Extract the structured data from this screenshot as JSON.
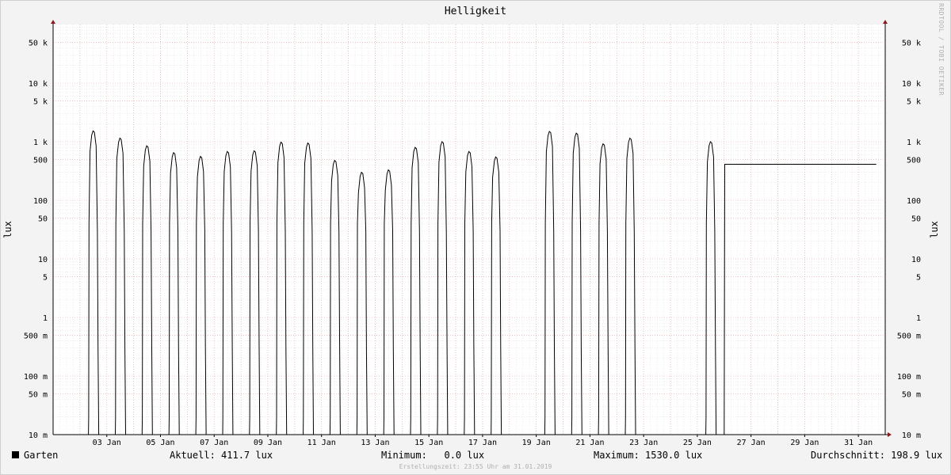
{
  "chart_data": {
    "type": "line",
    "title": "Helligkeit",
    "ylabel": "lux",
    "y_scale": "log",
    "ylim": [
      0.01,
      100000
    ],
    "xlim": [
      "2019-01-01T00:00",
      "2019-02-01T00:00"
    ],
    "y_ticks": [
      {
        "value": 0.01,
        "label": "10 m"
      },
      {
        "value": 0.05,
        "label": "50 m"
      },
      {
        "value": 0.1,
        "label": "100 m"
      },
      {
        "value": 0.5,
        "label": "500 m"
      },
      {
        "value": 1,
        "label": "1"
      },
      {
        "value": 5,
        "label": "5"
      },
      {
        "value": 10,
        "label": "10"
      },
      {
        "value": 50,
        "label": "50"
      },
      {
        "value": 100,
        "label": "100"
      },
      {
        "value": 500,
        "label": "500"
      },
      {
        "value": 1000,
        "label": "1 k"
      },
      {
        "value": 5000,
        "label": "5 k"
      },
      {
        "value": 10000,
        "label": "10 k"
      },
      {
        "value": 50000,
        "label": "50 k"
      }
    ],
    "x_ticks": [
      {
        "value": "2019-01-03",
        "label": "03 Jan"
      },
      {
        "value": "2019-01-05",
        "label": "05 Jan"
      },
      {
        "value": "2019-01-07",
        "label": "07 Jan"
      },
      {
        "value": "2019-01-09",
        "label": "09 Jan"
      },
      {
        "value": "2019-01-11",
        "label": "11 Jan"
      },
      {
        "value": "2019-01-13",
        "label": "13 Jan"
      },
      {
        "value": "2019-01-15",
        "label": "15 Jan"
      },
      {
        "value": "2019-01-17",
        "label": "17 Jan"
      },
      {
        "value": "2019-01-19",
        "label": "19 Jan"
      },
      {
        "value": "2019-01-21",
        "label": "21 Jan"
      },
      {
        "value": "2019-01-23",
        "label": "23 Jan"
      },
      {
        "value": "2019-01-25",
        "label": "25 Jan"
      },
      {
        "value": "2019-01-27",
        "label": "27 Jan"
      },
      {
        "value": "2019-01-29",
        "label": "29 Jan"
      },
      {
        "value": "2019-01-31",
        "label": "31 Jan"
      }
    ],
    "grid": true,
    "series": [
      {
        "name": "Garten",
        "color": "#000000",
        "daily_peaks": [
          {
            "date": "2019-01-02",
            "peak": 1530
          },
          {
            "date": "2019-01-03",
            "peak": 1150
          },
          {
            "date": "2019-01-04",
            "peak": 850
          },
          {
            "date": "2019-01-05",
            "peak": 650
          },
          {
            "date": "2019-01-06",
            "peak": 560
          },
          {
            "date": "2019-01-07",
            "peak": 680
          },
          {
            "date": "2019-01-08",
            "peak": 700
          },
          {
            "date": "2019-01-09",
            "peak": 980
          },
          {
            "date": "2019-01-10",
            "peak": 950
          },
          {
            "date": "2019-01-11",
            "peak": 480
          },
          {
            "date": "2019-01-12",
            "peak": 300
          },
          {
            "date": "2019-01-13",
            "peak": 330
          },
          {
            "date": "2019-01-14",
            "peak": 800
          },
          {
            "date": "2019-01-15",
            "peak": 1000
          },
          {
            "date": "2019-01-16",
            "peak": 680
          },
          {
            "date": "2019-01-17",
            "peak": 550
          },
          {
            "date": "2019-01-19",
            "peak": 1500
          },
          {
            "date": "2019-01-20",
            "peak": 1400
          },
          {
            "date": "2019-01-21",
            "peak": 920
          },
          {
            "date": "2019-01-22",
            "peak": 1150
          },
          {
            "date": "2019-01-25",
            "peak": 1000
          },
          {
            "date": "2019-01-26",
            "peak": 411.7
          }
        ]
      }
    ]
  },
  "legend": {
    "series_label": "Garten",
    "current": "Aktuell: 411.7 lux",
    "minimum": "Minimum:   0.0 lux",
    "maximum": "Maximum: 1530.0 lux",
    "average": "Durchschnitt: 198.9 lux"
  },
  "footer": "Erstellungszeit: 23:55 Uhr am 31.01.2019",
  "watermark": "RRDTOOL / TOBI OETIKER",
  "colors": {
    "background": "#f3f3f3",
    "plot_background": "#ffffff",
    "major_grid": "#e8a0a0",
    "minor_grid": "#d8d8d8",
    "axis": "#000000",
    "arrow": "#8b1a1a"
  }
}
